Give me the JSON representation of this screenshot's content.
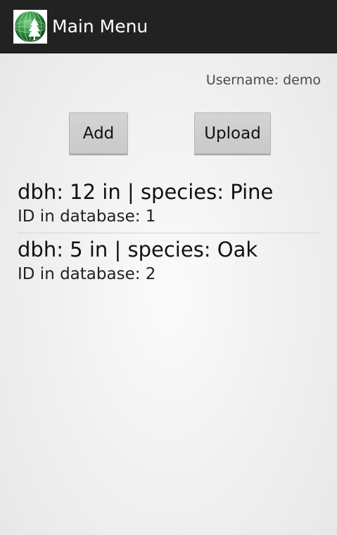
{
  "action_bar": {
    "icon": "forest-globe-icon",
    "title": "Main Menu"
  },
  "user": {
    "username_label": "Username: demo"
  },
  "buttons": {
    "add_label": "Add",
    "upload_label": "Upload"
  },
  "records": [
    {
      "title": "dbh: 12 in | species: Pine",
      "id_text": "ID in database: 1"
    },
    {
      "title": "dbh: 5 in | species: Oak",
      "id_text": "ID in database: 2"
    }
  ],
  "colors": {
    "action_bar": "#222222",
    "icon_globe": "#1f7a2e",
    "button": "#d0d0d0"
  }
}
